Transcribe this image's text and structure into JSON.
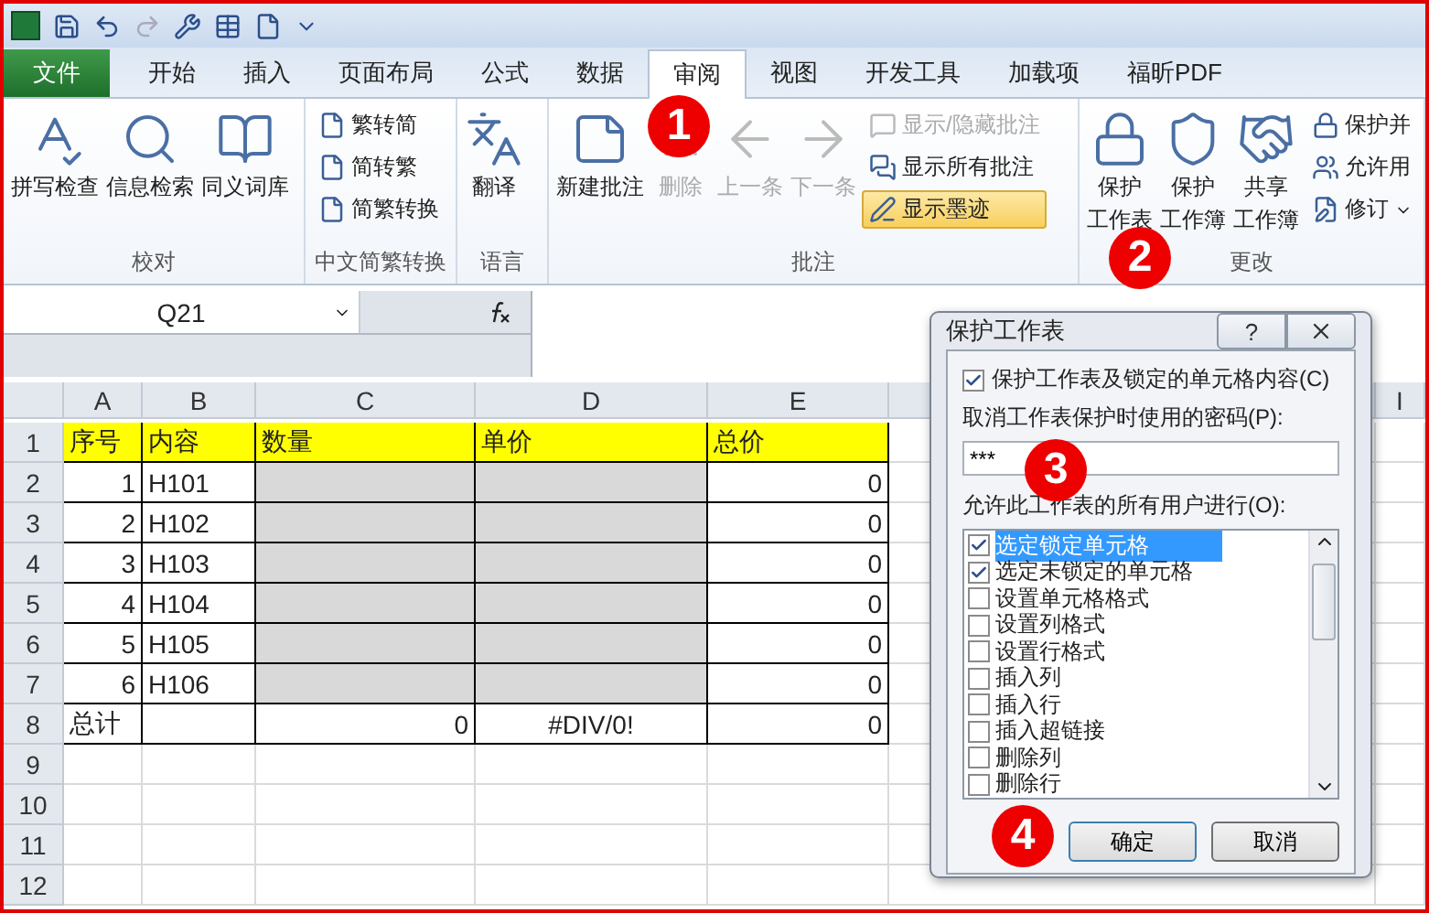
{
  "tabs": [
    {
      "label": "文件",
      "kind": "file",
      "selected": false
    },
    {
      "label": "开始",
      "kind": "normal",
      "selected": false
    },
    {
      "label": "插入",
      "kind": "normal",
      "selected": false
    },
    {
      "label": "页面布局",
      "kind": "normal",
      "selected": false
    },
    {
      "label": "公式",
      "kind": "normal",
      "selected": false
    },
    {
      "label": "数据",
      "kind": "normal",
      "selected": false
    },
    {
      "label": "审阅",
      "kind": "normal",
      "selected": true
    },
    {
      "label": "视图",
      "kind": "normal",
      "selected": false
    },
    {
      "label": "开发工具",
      "kind": "normal",
      "selected": false
    },
    {
      "label": "加载项",
      "kind": "normal",
      "selected": false
    },
    {
      "label": "福昕PDF",
      "kind": "normal",
      "selected": false
    }
  ],
  "ribbon": [
    {
      "label": "校对",
      "buttons": [
        {
          "lines": [
            "拼写检查"
          ],
          "kind": "large"
        },
        {
          "lines": [
            "信息检索"
          ],
          "kind": "large"
        },
        {
          "lines": [
            "同义词库"
          ],
          "kind": "large"
        }
      ]
    },
    {
      "label": "中文简繁转换",
      "buttons": [
        {
          "lines": [
            "繁转简"
          ],
          "kind": "small"
        },
        {
          "lines": [
            "简转繁"
          ],
          "kind": "small"
        },
        {
          "lines": [
            "简繁转换"
          ],
          "kind": "small"
        }
      ]
    },
    {
      "label": "语言",
      "buttons": [
        {
          "lines": [
            "翻译"
          ],
          "kind": "large"
        }
      ]
    },
    {
      "label": "批注",
      "buttons": [
        {
          "lines": [
            "新建批注"
          ],
          "kind": "large",
          "disabled": false,
          "on": false
        },
        {
          "lines": [
            "删除"
          ],
          "kind": "large",
          "disabled": true,
          "on": false
        },
        {
          "lines": [
            "上一条"
          ],
          "kind": "large",
          "disabled": true,
          "on": false
        },
        {
          "lines": [
            "下一条"
          ],
          "kind": "large",
          "disabled": true,
          "on": false
        },
        {
          "lines": [
            "显示/隐藏批注"
          ],
          "kind": "small",
          "disabled": true,
          "on": false
        },
        {
          "lines": [
            "显示所有批注"
          ],
          "kind": "small",
          "disabled": false,
          "on": false
        },
        {
          "lines": [
            "显示墨迹"
          ],
          "kind": "small",
          "disabled": false,
          "on": true
        }
      ]
    },
    {
      "label": "更改",
      "buttons": [
        {
          "lines": [
            "保护",
            "工作表"
          ],
          "kind": "large"
        },
        {
          "lines": [
            "保护",
            "工作簿"
          ],
          "kind": "large"
        },
        {
          "lines": [
            "共享",
            "工作簿"
          ],
          "kind": "large"
        },
        {
          "lines": [
            "保护并"
          ],
          "kind": "small"
        },
        {
          "lines": [
            "允许用"
          ],
          "kind": "small"
        },
        {
          "lines": [
            "修订"
          ],
          "kind": "small",
          "dropdown": true
        }
      ]
    }
  ],
  "formula_bar": {
    "name_box": "Q21"
  },
  "sheet": {
    "columns": [
      "A",
      "B",
      "C",
      "D",
      "E",
      "I"
    ],
    "rows": [
      {
        "number": "1",
        "kind": "header",
        "cells": [
          "序号",
          "内容",
          "数量",
          "单价",
          "总价"
        ]
      },
      {
        "number": "2",
        "kind": "data",
        "cells": [
          "1",
          "H101",
          null,
          null,
          "0"
        ]
      },
      {
        "number": "3",
        "kind": "data",
        "cells": [
          "2",
          "H102",
          null,
          null,
          "0"
        ]
      },
      {
        "number": "4",
        "kind": "data",
        "cells": [
          "3",
          "H103",
          null,
          null,
          "0"
        ]
      },
      {
        "number": "5",
        "kind": "data",
        "cells": [
          "4",
          "H104",
          null,
          null,
          "0"
        ]
      },
      {
        "number": "6",
        "kind": "data",
        "cells": [
          "5",
          "H105",
          null,
          null,
          "0"
        ]
      },
      {
        "number": "7",
        "kind": "data",
        "cells": [
          "6",
          "H106",
          null,
          null,
          "0"
        ]
      },
      {
        "number": "8",
        "kind": "total",
        "cells": [
          "总计",
          null,
          "0",
          "#DIV/0!",
          "0"
        ]
      },
      {
        "number": "9",
        "kind": "empty"
      },
      {
        "number": "10",
        "kind": "empty"
      },
      {
        "number": "11",
        "kind": "empty"
      },
      {
        "number": "12",
        "kind": "empty"
      }
    ]
  },
  "dialog": {
    "title": "保护工作表",
    "help": "?",
    "protect": {
      "label": "保护工作表及锁定的单元格内容(C)",
      "checked": true
    },
    "password_label": "取消工作表保护时使用的密码(P):",
    "password": "***",
    "allow_label": "允许此工作表的所有用户进行(O):",
    "permissions": [
      {
        "label": "选定锁定单元格",
        "checked": true,
        "selected": true
      },
      {
        "label": "选定未锁定的单元格",
        "checked": true,
        "selected": false
      },
      {
        "label": "设置单元格格式",
        "checked": false,
        "selected": false
      },
      {
        "label": "设置列格式",
        "checked": false,
        "selected": false
      },
      {
        "label": "设置行格式",
        "checked": false,
        "selected": false
      },
      {
        "label": "插入列",
        "checked": false,
        "selected": false
      },
      {
        "label": "插入行",
        "checked": false,
        "selected": false
      },
      {
        "label": "插入超链接",
        "checked": false,
        "selected": false
      },
      {
        "label": "删除列",
        "checked": false,
        "selected": false
      },
      {
        "label": "删除行",
        "checked": false,
        "selected": false
      }
    ],
    "buttons": [
      "确定",
      "取消"
    ]
  },
  "annotations": [
    "1",
    "2",
    "3",
    "4"
  ]
}
